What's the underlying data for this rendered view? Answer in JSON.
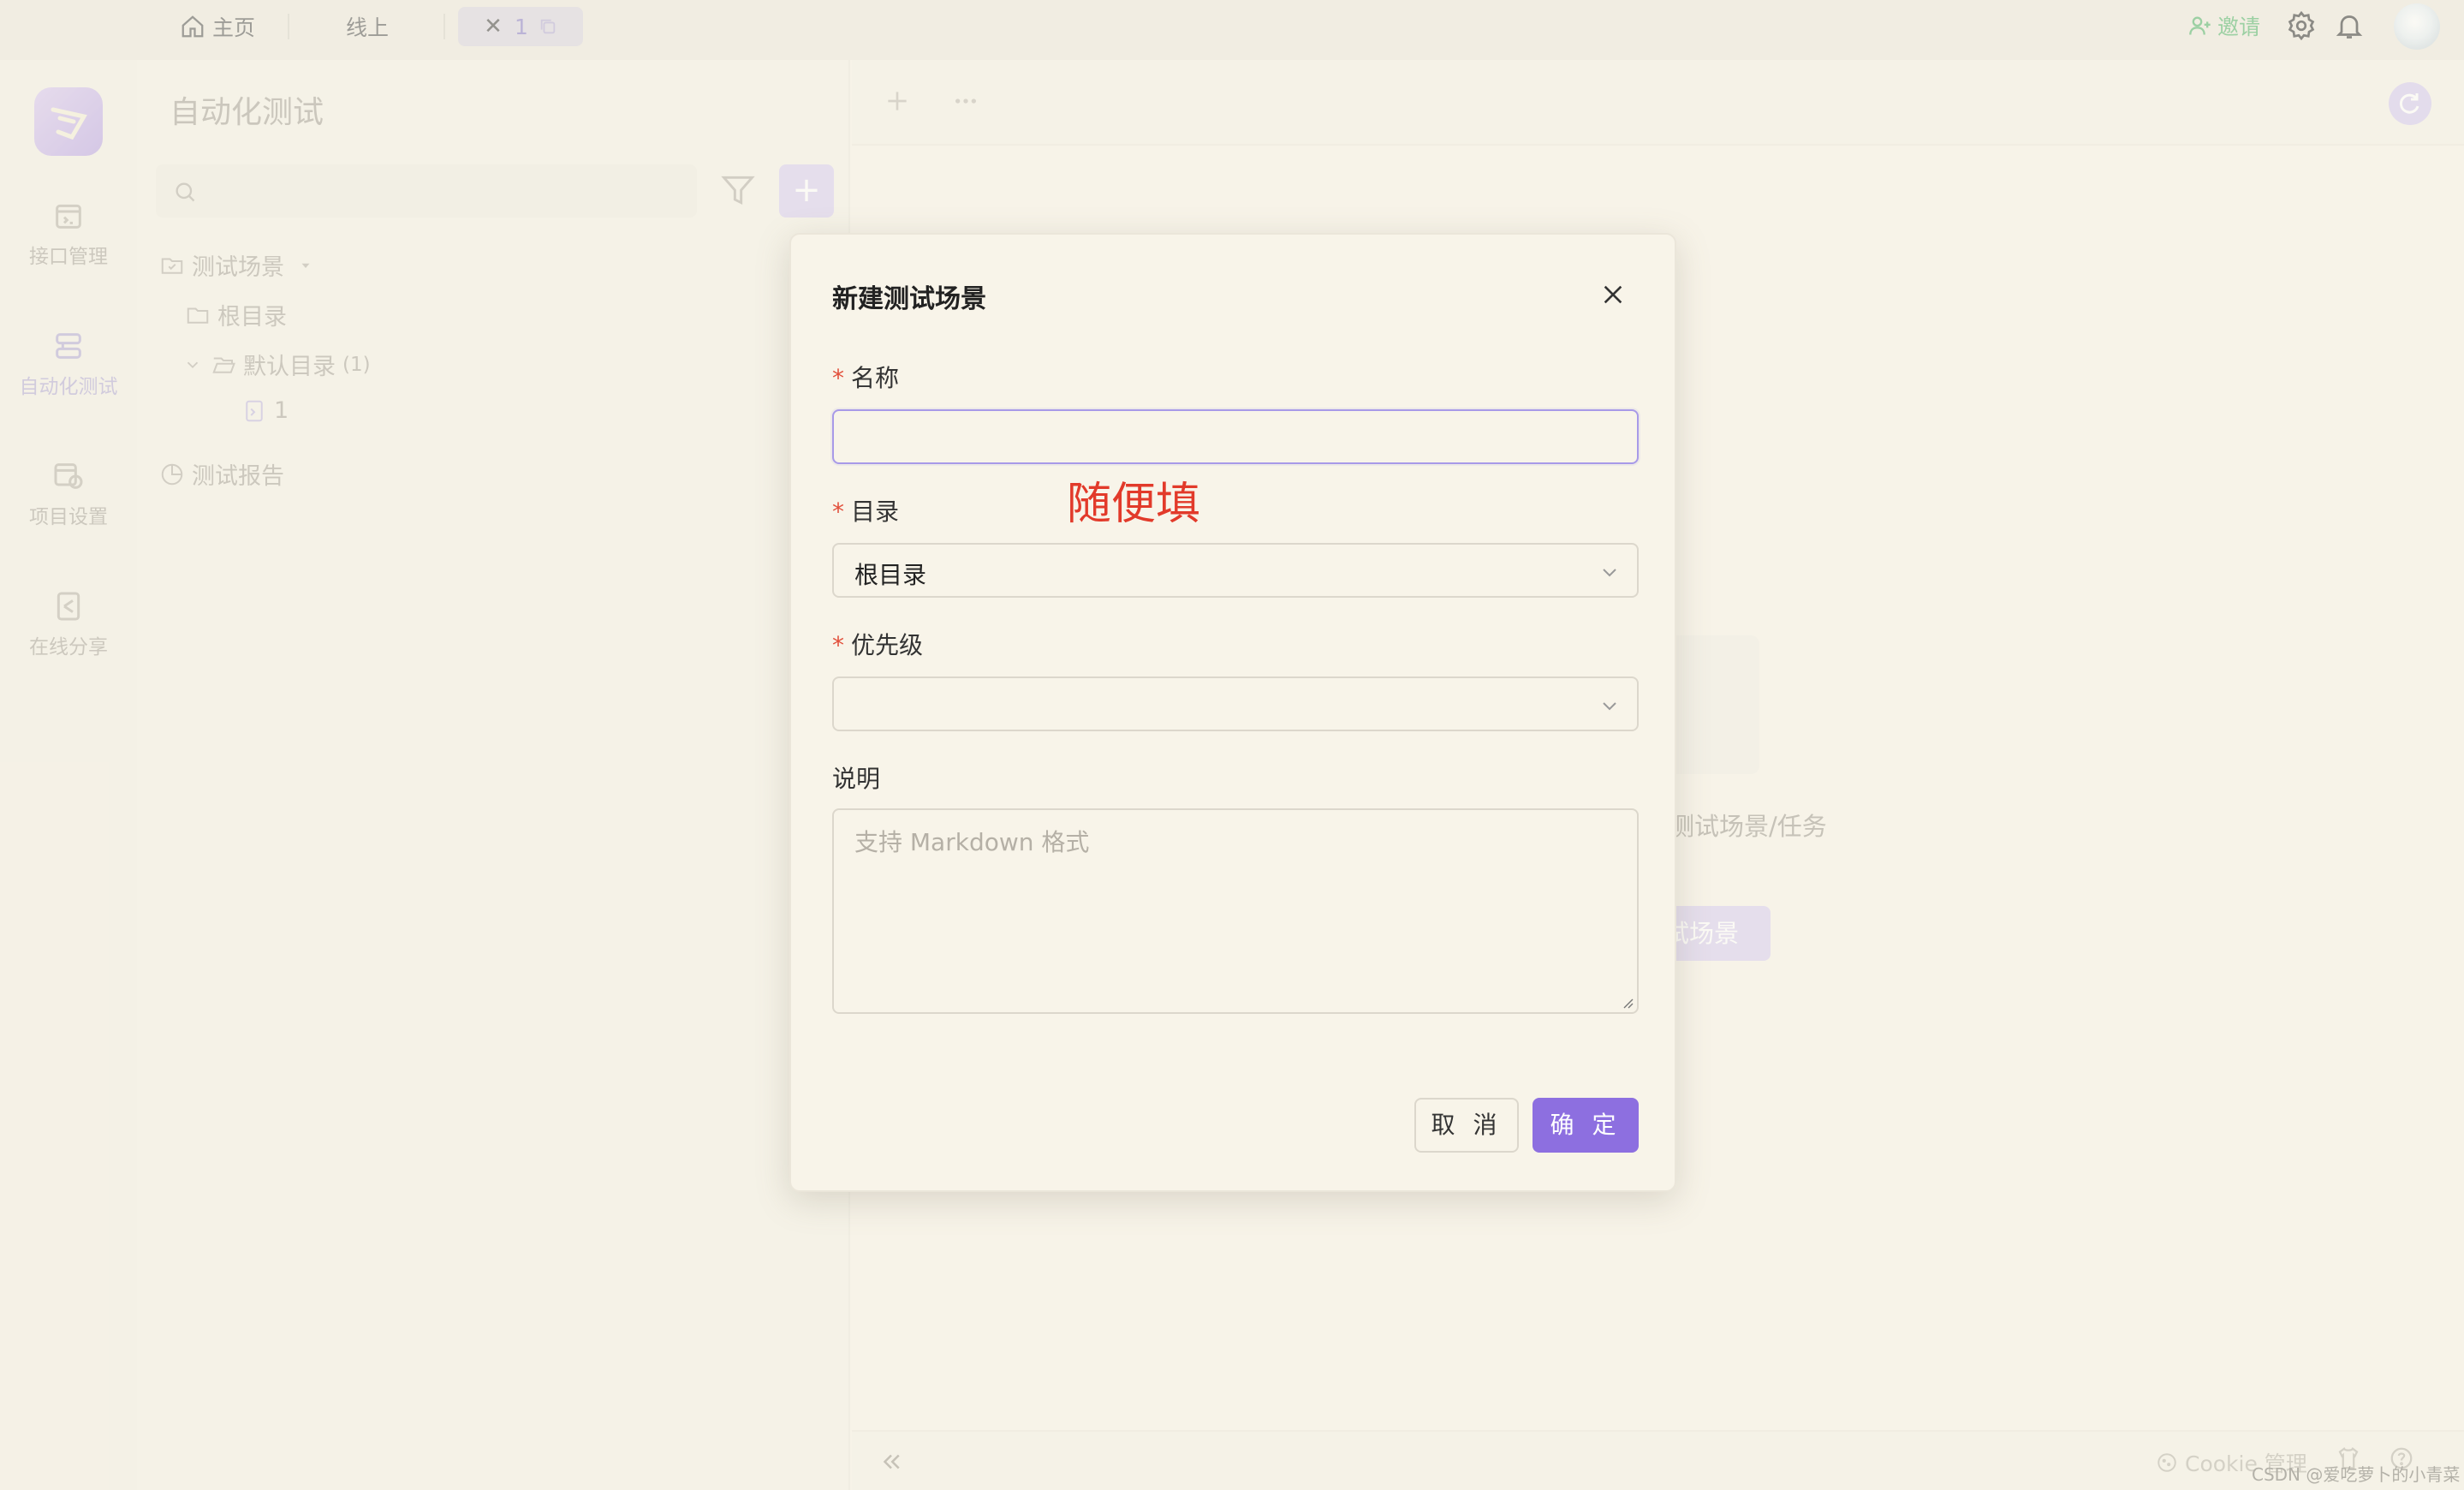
{
  "topbar": {
    "tabs": [
      {
        "label": "主页",
        "icon": "home-icon"
      },
      {
        "label": "线上"
      },
      {
        "label": "1",
        "active": true
      }
    ],
    "invite_label": "邀请",
    "accent_invite": "#52b36a"
  },
  "rail": {
    "items": [
      {
        "label": "接口管理",
        "icon": "api-icon"
      },
      {
        "label": "自动化测试",
        "icon": "automation-icon",
        "active": true
      },
      {
        "label": "项目设置",
        "icon": "settings-icon"
      },
      {
        "label": "在线分享",
        "icon": "share-icon"
      }
    ]
  },
  "tree": {
    "title": "自动化测试",
    "search_placeholder": "",
    "items": [
      {
        "label": "测试场景"
      },
      {
        "label": "根目录"
      },
      {
        "label": "默认目录",
        "count": "(1)"
      },
      {
        "label": "1"
      },
      {
        "label": "测试报告"
      }
    ]
  },
  "main": {
    "empty_text": "测试场景/任务",
    "empty_button": "试场景"
  },
  "bottombar": {
    "cookie_label": "Cookie 管理",
    "watermark": "CSDN @爱吃萝卜的小青菜"
  },
  "dialog": {
    "title": "新建测试场景",
    "fields": {
      "name": {
        "label": "名称",
        "required": "*",
        "value": ""
      },
      "directory": {
        "label": "目录",
        "required": "*",
        "value": "根目录"
      },
      "priority": {
        "label": "优先级",
        "required": "*",
        "value": ""
      },
      "description": {
        "label": "说明",
        "placeholder": "支持 Markdown 格式"
      }
    },
    "annotation": "随便填",
    "cancel_label": "取 消",
    "ok_label": "确 定"
  },
  "colors": {
    "primary": "#8d6fe0",
    "required": "#e2503c",
    "annotation": "#e23a2a"
  }
}
